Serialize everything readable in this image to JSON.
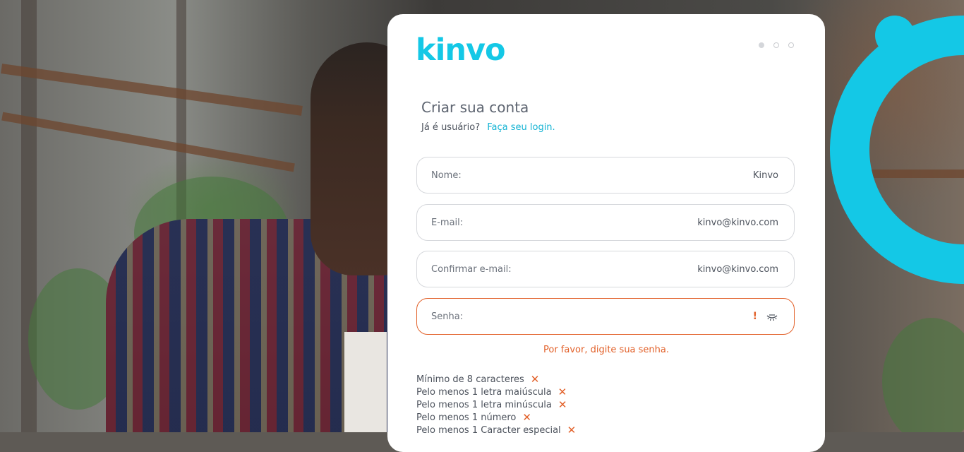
{
  "brand": {
    "logo_text": "kinvo",
    "accent_color": "#14c8e6",
    "error_color": "#e2612a"
  },
  "steps": {
    "total": 3,
    "current": 1
  },
  "form": {
    "title": "Criar sua conta",
    "login_prompt": "Já é usuário?",
    "login_link": "Faça seu login.",
    "fields": {
      "name": {
        "label": "Nome:",
        "value": "Kinvo"
      },
      "email": {
        "label": "E-mail:",
        "value": "kinvo@kinvo.com"
      },
      "confirm_email": {
        "label": "Confirmar e-mail:",
        "value": "kinvo@kinvo.com"
      },
      "password": {
        "label": "Senha:",
        "value": "",
        "warning_icon": "!",
        "toggle_icon": "eye-closed-icon"
      }
    },
    "password_error": "Por favor, digite sua senha.",
    "password_rules": [
      {
        "text": "Mínimo de 8 caracteres",
        "status_icon": "✕"
      },
      {
        "text": "Pelo menos 1 letra maiúscula",
        "status_icon": "✕"
      },
      {
        "text": "Pelo menos 1 letra minúscula",
        "status_icon": "✕"
      },
      {
        "text": "Pelo menos 1 número",
        "status_icon": "✕"
      },
      {
        "text": "Pelo menos 1 Caracter especial",
        "status_icon": "✕"
      }
    ]
  }
}
